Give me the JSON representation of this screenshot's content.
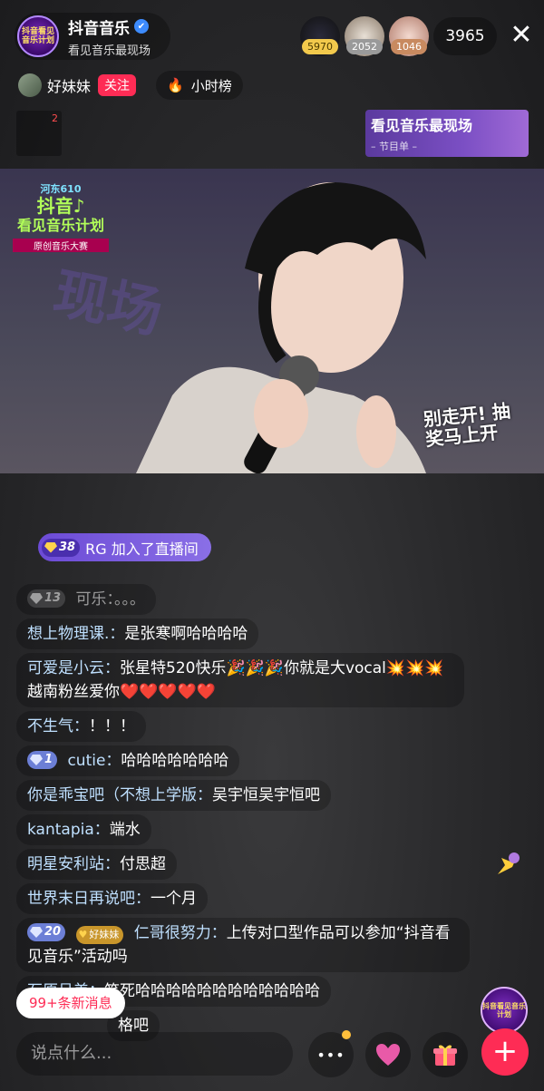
{
  "header": {
    "room_name": "抖音音乐",
    "room_subtitle": "看见音乐最现场",
    "room_logo_text": "抖音看见音乐计划",
    "viewers": [
      {
        "count": "5970",
        "color": "#f2c94c"
      },
      {
        "count": "2052",
        "color": "#d9d9d9"
      },
      {
        "count": "1046",
        "color": "#e0a070"
      }
    ],
    "total_viewers": "3965",
    "close": "✕"
  },
  "host": {
    "name": "好妹妹",
    "follow_label": "关注",
    "rank_label": "小时榜"
  },
  "side": {
    "notification_count": "2",
    "program_title": "看见音乐最现场",
    "program_sub": "– 节目单 –"
  },
  "video": {
    "logo_line1": "河东610",
    "logo_line2": "抖音♪",
    "logo_line3": "看见音乐计划",
    "logo_line4": "原创音乐大赛",
    "bg_text": "现场",
    "overlay_text": "别走开! 抽奖马上开"
  },
  "join_banner": {
    "level": "38",
    "text": "RG 加入了直播间"
  },
  "messages": [
    {
      "level": "13",
      "user": "可乐：",
      "text": "。。。",
      "faded": true
    },
    {
      "user": "想上物理课.：",
      "text": "是张寒啊哈哈哈哈"
    },
    {
      "user": "可爱是小云：",
      "text": "张星特520快乐🎉🎉🎉你就是大vocal💥💥💥越南粉丝爱你❤️❤️❤️❤️❤️"
    },
    {
      "user": "不生气：",
      "text": "！！！"
    },
    {
      "level": "1",
      "user": "cutie：",
      "text": "哈哈哈哈哈哈哈"
    },
    {
      "user": "你是乖宝吧（不想上学版：",
      "text": "吴宇恒吴宇恒吧"
    },
    {
      "user": "kantapia：",
      "text": "端水"
    },
    {
      "user": "明星安利站：",
      "text": "付思超"
    },
    {
      "user": "世界末日再说吧：",
      "text": "一个月"
    },
    {
      "level": "20",
      "fan_badge": "好妹妹",
      "user": "仁哥很努力：",
      "text": "上传对口型作品可以参加“抖音看见音乐”活动吗"
    },
    {
      "user": "石原吕美：",
      "text": "笑死哈哈哈哈哈哈哈哈哈哈哈哈"
    },
    {
      "user": "",
      "text": "格吧"
    }
  ],
  "new_messages": "99+条新消息",
  "input_placeholder": "说点什么...",
  "buttons": {
    "more": "•••",
    "plus": "+"
  }
}
